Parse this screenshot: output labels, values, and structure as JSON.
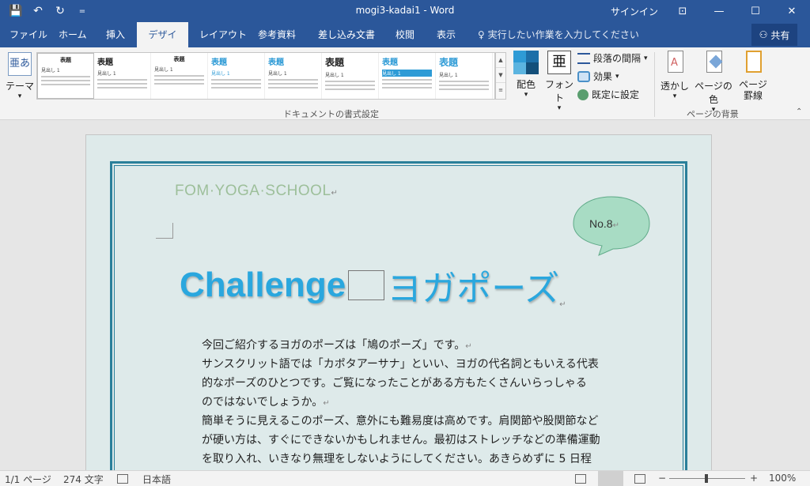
{
  "titlebar": {
    "title": "mogi3-kadai1  -  Word",
    "signin": "サインイン",
    "qat": {
      "save_icon": "💾",
      "undo_icon": "↶",
      "redo_icon": "↻",
      "customize_icon": "="
    },
    "window": {
      "ribbon_display_icon": "⊡",
      "minimize_icon": "—",
      "maximize_icon": "☐",
      "close_icon": "✕"
    }
  },
  "tabs": [
    {
      "label": "ファイル"
    },
    {
      "label": "ホーム"
    },
    {
      "label": "挿入"
    },
    {
      "label": "デザイン"
    },
    {
      "label": "レイアウト"
    },
    {
      "label": "参考資料"
    },
    {
      "label": "差し込み文書"
    },
    {
      "label": "校閲"
    },
    {
      "label": "表示"
    }
  ],
  "tell_me": {
    "icon": "lightbulb-icon",
    "glyph": "♀",
    "text": "実行したい作業を入力してください"
  },
  "share": {
    "label": "共有",
    "icon_glyph": "⚇"
  },
  "ribbon": {
    "theme": {
      "label": "テーマ",
      "icon_text": "亜あ"
    },
    "gallery_items": [
      {
        "title": "表題",
        "head": "見出し 1"
      },
      {
        "title": "表題",
        "head": "見出し 1"
      },
      {
        "title": "表題",
        "head": "見出し 1"
      },
      {
        "title": "表題",
        "head": "見出し 1"
      },
      {
        "title": "表題",
        "head": "見出し 1"
      },
      {
        "title": "表題",
        "head": "見出し 1"
      },
      {
        "title": "表題",
        "head": "見出し 1"
      },
      {
        "title": "表題",
        "head": "見出し 1"
      }
    ],
    "gallery_scroll": [
      "▲",
      "▼",
      "≡"
    ],
    "colors_label": "配色",
    "fonts_label": "フォント",
    "fonts_icon_text": "亜",
    "paragraph_spacing_label": "段落の間隔",
    "effects_label": "効果",
    "set_default_label": "既定に設定",
    "dropdown_glyph": "▾",
    "watermark_label": "透かし",
    "page_color_label": "ページの色",
    "page_borders_label": "ページ\n罫線",
    "group_doc_format": "ドキュメントの書式設定",
    "group_page_bg": "ページの背景",
    "collapse_glyph": "⌃"
  },
  "document": {
    "school": "FOM·YOGA·SCHOOL",
    "no_label": "No.8",
    "para_mark": "↵",
    "headline_latin": "Challenge",
    "headline_jp": "ヨガポーズ",
    "paragraphs": [
      "今回ご紹介するヨガのポーズは「鳩のポーズ」です。",
      "サンスクリット語では「カポタアーサナ」といい、ヨガの代名詞ともいえる代表",
      "的なポーズのひとつです。ご覧になったことがある方もたくさんいらっしゃる",
      "のではないでしょうか。",
      "簡単そうに見えるこのポーズ、意外にも難易度は高めです。肩関節や股関節など",
      "が硬い方は、すぐにできないかもしれません。最初はストレッチなどの準備運動",
      "を取り入れ、いきなり無理をしないようにしてください。あきらめずに 5 日程"
    ]
  },
  "statusbar": {
    "page": "1/1 ページ",
    "words": "274 文字",
    "proofing_icon": "proofing-icon",
    "language": "日本語",
    "zoom": "100%",
    "zoom_out": "−",
    "zoom_in": "+"
  },
  "colors": {
    "accent": "#2b579a",
    "headline": "#2aa7de",
    "frame": "#2a7f9a",
    "page_bg": "#deeaea",
    "school_text": "#9dbf9a",
    "bubble_fill": "#a8dcc4"
  }
}
